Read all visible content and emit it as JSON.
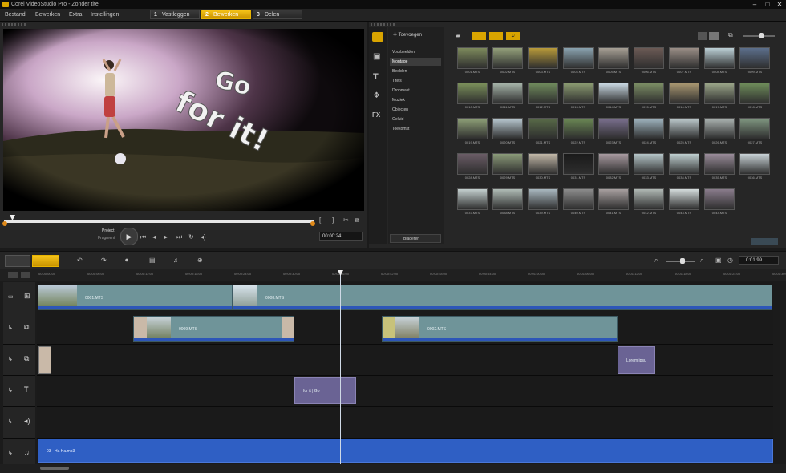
{
  "app": {
    "title": "Corel VideoStudio Pro - Zonder titel"
  },
  "menu": [
    "Bestand",
    "Bewerken",
    "Extra",
    "Instellingen"
  ],
  "steps": [
    {
      "num": "1",
      "label": "Vastleggen"
    },
    {
      "num": "2",
      "label": "Bewerken"
    },
    {
      "num": "3",
      "label": "Delen"
    }
  ],
  "preview": {
    "overlay_line1": "Go",
    "overlay_line2": "for it!",
    "project_label": "Project",
    "clip_label": "Fragment",
    "timecode": "00:00:24:",
    "bracket_in": "[",
    "bracket_out": "]"
  },
  "library": {
    "import_label": "Toevoegen",
    "nav": [
      "Voorbeelden",
      "Montage",
      "Beelden",
      "Titels",
      "Dropmast",
      "Muziek",
      "Objecten",
      "Geluid",
      "Toekomst"
    ],
    "bottom_label": "Bladeren",
    "thumbs": [
      "0001.MTS",
      "0002.MTS",
      "0003.MTS",
      "0004.MTS",
      "0005.MTS",
      "0006.MTS",
      "0007.MTS",
      "0008.MTS",
      "0009.MTS",
      "0010.MTS",
      "0011.MTS",
      "0012.MTS",
      "0013.MTS",
      "0014.MTS",
      "0015.MTS",
      "0016.MTS",
      "0017.MTS",
      "0018.MTS",
      "0019.MTS",
      "0020.MTS",
      "0021.MTS",
      "0022.MTS",
      "0023.MTS",
      "0024.MTS",
      "0025.MTS",
      "0026.MTS",
      "0027.MTS",
      "0028.MTS",
      "0029.MTS",
      "0030.MTS",
      "0031.MTS",
      "0032.MTS",
      "0033.MTS",
      "0034.MTS",
      "0035.MTS",
      "0036.MTS",
      "0037.MTS",
      "0038.MTS",
      "0039.MTS",
      "0040.MTS",
      "0041.MTS",
      "0042.MTS",
      "0043.MTS",
      "0044.MTS"
    ],
    "thumb_colors": [
      "#7d8a5c",
      "#93a07a",
      "#b89a3a",
      "#8aa3b0",
      "#a7a095",
      "#6b5a55",
      "#9a8e86",
      "#bcd0d6",
      "#5c6f8c",
      "#7a8f5a",
      "#a5b3a8",
      "#6f8a5c",
      "#8a9a70",
      "#c9d8e2",
      "#7b8d64",
      "#a89670",
      "#9aa588",
      "#6e8c5a",
      "#8ea077",
      "#b8c8d0",
      "#586a48",
      "#6a8754",
      "#7a6f8e",
      "#9fb4bf",
      "#bcc9cc",
      "#aab2b0",
      "#7f9680",
      "#6a5c66",
      "#8a9a78",
      "#c2b8a8",
      "#1a1a1a",
      "#a89aa0",
      "#b5c5c8",
      "#bfcfd0",
      "#9a8c9a",
      "#c8d2d6",
      "#c4d0cf",
      "#b0bcb6",
      "#a9b8c0",
      "#8c8c8c",
      "#a8a0a0",
      "#b0b8b4",
      "#d4dcdc",
      "#8a7c8c"
    ]
  },
  "timeline": {
    "ticks": [
      "00:00:00:00",
      "00:00:06:00",
      "00:00:12:00",
      "00:00:18:00",
      "00:00:24:00",
      "00:00:30:00",
      "00:00:36:00",
      "00:00:42:00",
      "00:00:48:00",
      "00:00:54:00",
      "00:01:00:00",
      "00:01:06:00",
      "00:01:12:00",
      "00:01:18:00",
      "00:01:24:00",
      "00:01:30:00"
    ],
    "zoom_value": "0:01:99",
    "video_clips": [
      "0001.MTS",
      "0008.MTS"
    ],
    "overlay_clips": [
      "0009.MTS",
      "0002.MTS"
    ],
    "title_clip1": "Lorem ipsu",
    "title_clip2": "for it | Go",
    "music_clip": "03 - Ha Ha.mp3"
  }
}
